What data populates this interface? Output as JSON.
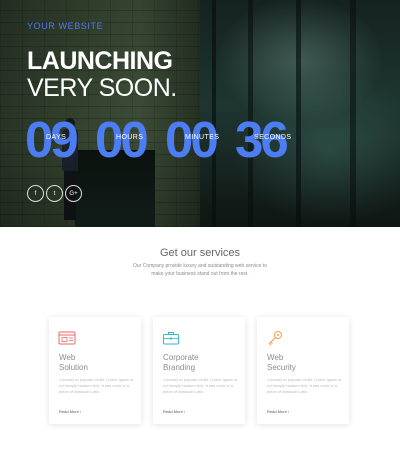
{
  "hero": {
    "brand": "YOUR WEBSITE",
    "headline_line1": "LAUNCHING",
    "headline_line2": "VERY SOON.",
    "countdown": [
      {
        "number": "09",
        "label": "DAYS"
      },
      {
        "number": "00",
        "label": "HOURS"
      },
      {
        "number": "00",
        "label": "MINUTES"
      },
      {
        "number": "36",
        "label": "SECONDS"
      }
    ],
    "socials": [
      {
        "icon": "facebook-icon",
        "glyph": "f"
      },
      {
        "icon": "twitter-icon",
        "glyph": "t"
      },
      {
        "icon": "google-plus-icon",
        "glyph": "G+"
      }
    ],
    "accent_color": "#4d7df2"
  },
  "services": {
    "title": "Get our services",
    "description": "Our Company provide luxury and outstanding web service to make your business stand out from the rest.",
    "cards": [
      {
        "icon": "web-browser-icon",
        "title_line1": "Web",
        "title_line2": "Solution",
        "text": "Contrary to popular belief, Lorem Ipsum is not simply random text. It has roots in a piece of classical Latin.",
        "link": "Read More ›",
        "icon_color": "#e86a6a"
      },
      {
        "icon": "briefcase-icon",
        "title_line1": "Corporate",
        "title_line2": "Branding",
        "text": "Contrary to popular belief, Lorem Ipsum is not simply random text. It has roots in a piece of classical Latin.",
        "link": "Read More ›",
        "icon_color": "#3ab7c9"
      },
      {
        "icon": "key-icon",
        "title_line1": "Web",
        "title_line2": "Security",
        "text": "Contrary to popular belief, Lorem Ipsum is not simply random text. It has roots in a piece of classical Latin.",
        "link": "Read More ›",
        "icon_color": "#f0a04a"
      }
    ]
  }
}
